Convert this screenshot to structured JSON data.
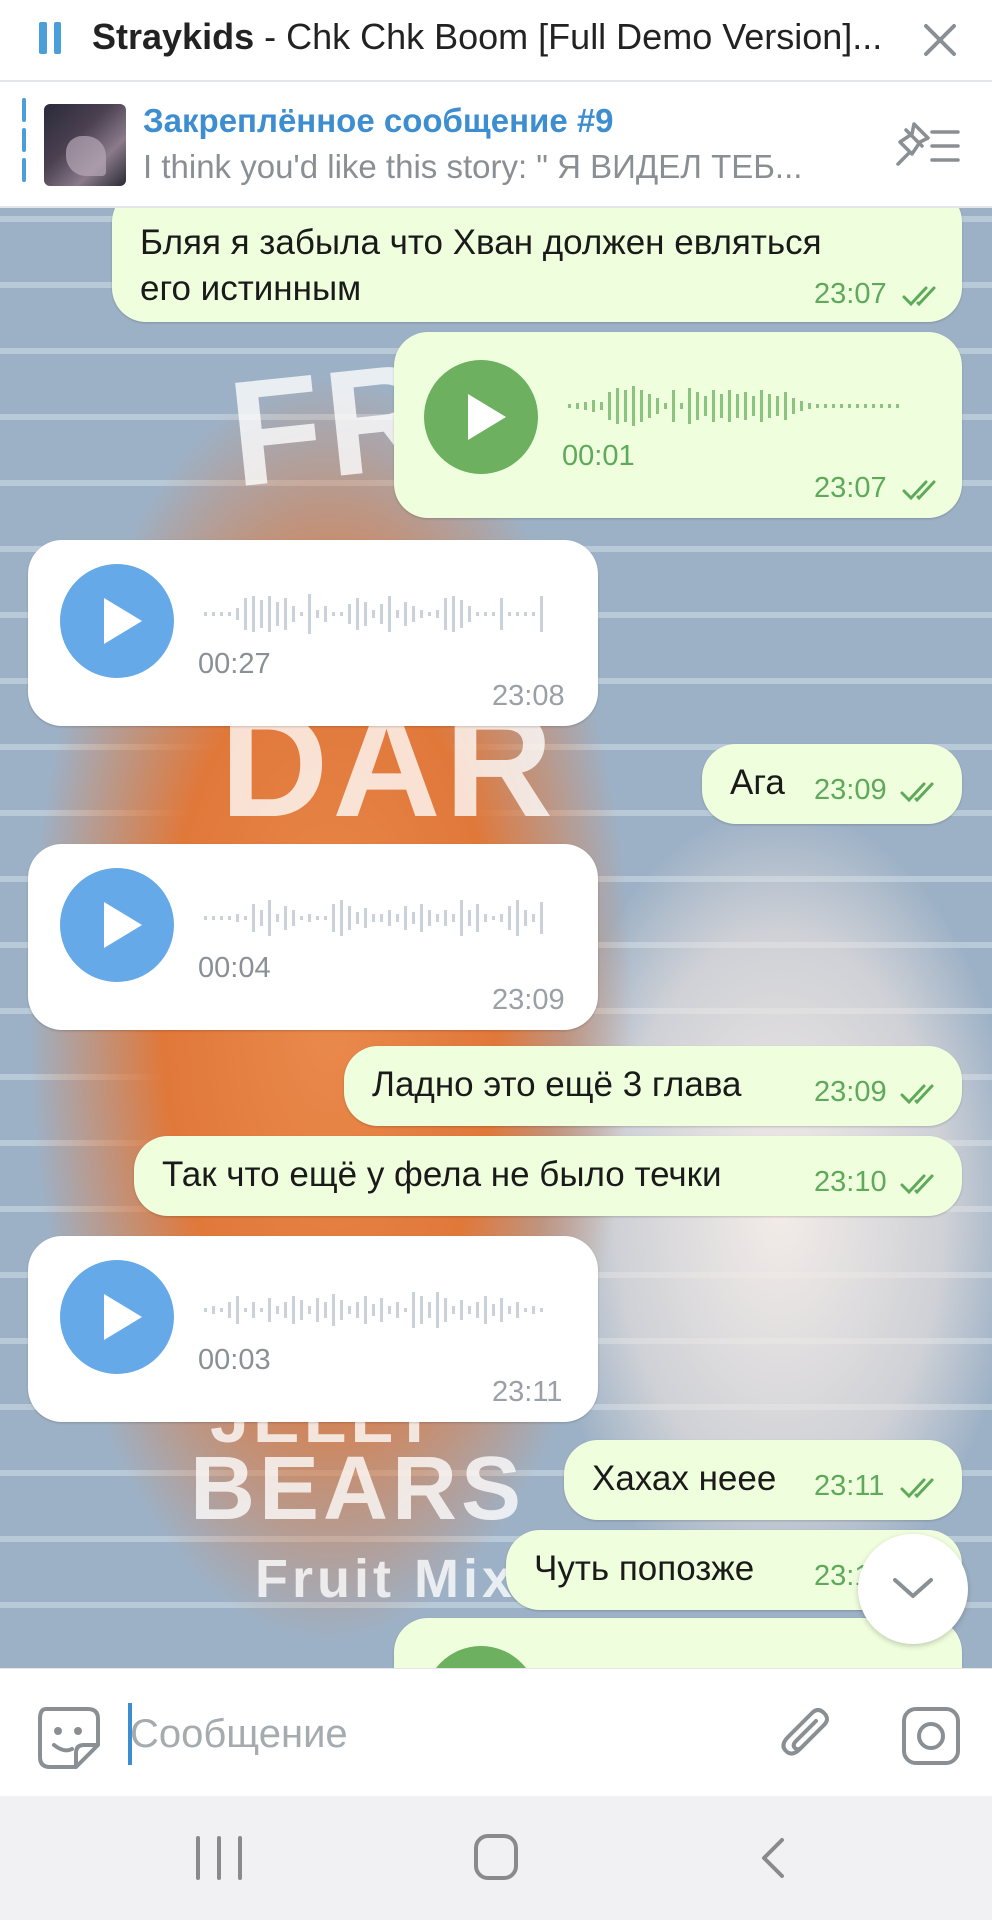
{
  "player": {
    "artist": "Straykids",
    "title_rest": " - Chk Chk Boom [Full Demo Version]..."
  },
  "pinned": {
    "title": "Закреплённое сообщение #9",
    "text": "I think you'd like this story: \" Я ВИДЕЛ ТЕБ..."
  },
  "background_text": [
    "FR",
    "DAR",
    "JELLY",
    "BEARS",
    "Fruit Mix"
  ],
  "messages": [
    {
      "type": "text",
      "dir": "out",
      "text_line1": "Бляя я забыла что Хван должен евляться",
      "text_line2": "его истинным",
      "time": "23:07",
      "read": true
    },
    {
      "type": "voice",
      "dir": "out",
      "duration": "00:01",
      "time": "23:07",
      "read": true
    },
    {
      "type": "voice",
      "dir": "in",
      "duration": "00:27",
      "time": "23:08"
    },
    {
      "type": "text",
      "dir": "out",
      "text": "Ага",
      "time": "23:09",
      "read": true
    },
    {
      "type": "voice",
      "dir": "in",
      "duration": "00:04",
      "time": "23:09"
    },
    {
      "type": "text",
      "dir": "out",
      "text": "Ладно это ещё 3 глава",
      "time": "23:09",
      "read": true
    },
    {
      "type": "text",
      "dir": "out",
      "text": "Так что ещё у фела не было течки",
      "time": "23:10",
      "read": true
    },
    {
      "type": "voice",
      "dir": "in",
      "duration": "00:03",
      "time": "23:11"
    },
    {
      "type": "text",
      "dir": "out",
      "text": "Хахах неее",
      "time": "23:11",
      "read": true
    },
    {
      "type": "text",
      "dir": "out",
      "text": "Чуть попозже",
      "time": "23:1",
      "read": true
    }
  ],
  "input": {
    "placeholder": "Сообщение"
  },
  "colors": {
    "accent": "#3d8ed0",
    "outgoing_bubble": "#effedd",
    "incoming_bubble": "#ffffff",
    "play_out": "#6cb060",
    "play_in": "#66a9e9",
    "time_out": "#5ea95a"
  },
  "icons": [
    "pause-icon",
    "close-icon",
    "pin-list-icon",
    "play-icon",
    "double-check-icon",
    "chevron-down-icon",
    "sticker-icon",
    "paperclip-icon",
    "camera-icon",
    "nav-recent-icon",
    "nav-home-icon",
    "nav-back-icon"
  ]
}
